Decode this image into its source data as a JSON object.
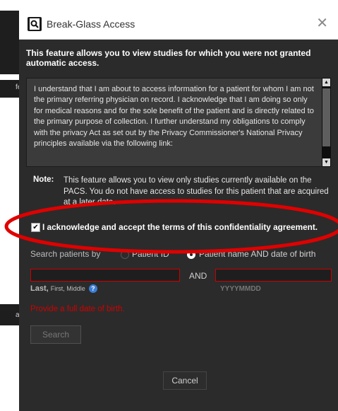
{
  "background": {
    "left_labels": [
      "fe",
      "at"
    ]
  },
  "dialog": {
    "title": "Break-Glass Access",
    "close_glyph": "✕",
    "intro": "This feature allows you to view studies for which you were not granted automatic access.",
    "terms_text": "I understand that I am about to access information for a patient for whom I am not the primary referring physician on record. I acknowledge that I am doing so only for medical reasons and for the sole benefit of the patient and is directly related to the primary purpose of collection.  I further understand my obligations to comply with the privacy Act as set out by the Privacy Commissioner's National Privacy principles available via the following link:",
    "note_label": "Note:",
    "note_text": "This feature allows you to view only studies currently available on the PACS. You do not have access to studies for this patient that are acquired at a later date.",
    "acknowledge": {
      "checked": true,
      "check_glyph": "✔",
      "label": "I acknowledge and accept the terms of this confidentiality agreement."
    },
    "search": {
      "label": "Search patients by",
      "options": [
        {
          "label": "Patient ID",
          "selected": false
        },
        {
          "label": "Patient name AND date of birth",
          "selected": true
        }
      ],
      "name_value": "",
      "and_label": "AND",
      "dob_value": "",
      "name_hint_bold": "Last,",
      "name_hint_small": "First, Middle",
      "help_glyph": "?",
      "dob_hint": "YYYYMMDD",
      "error": "Provide a full date of birth.",
      "button": "Search"
    },
    "cancel": "Cancel"
  },
  "colors": {
    "dialog_bg": "#2b2b2b",
    "error": "#d10000",
    "annotation_ring": "#e00000"
  }
}
